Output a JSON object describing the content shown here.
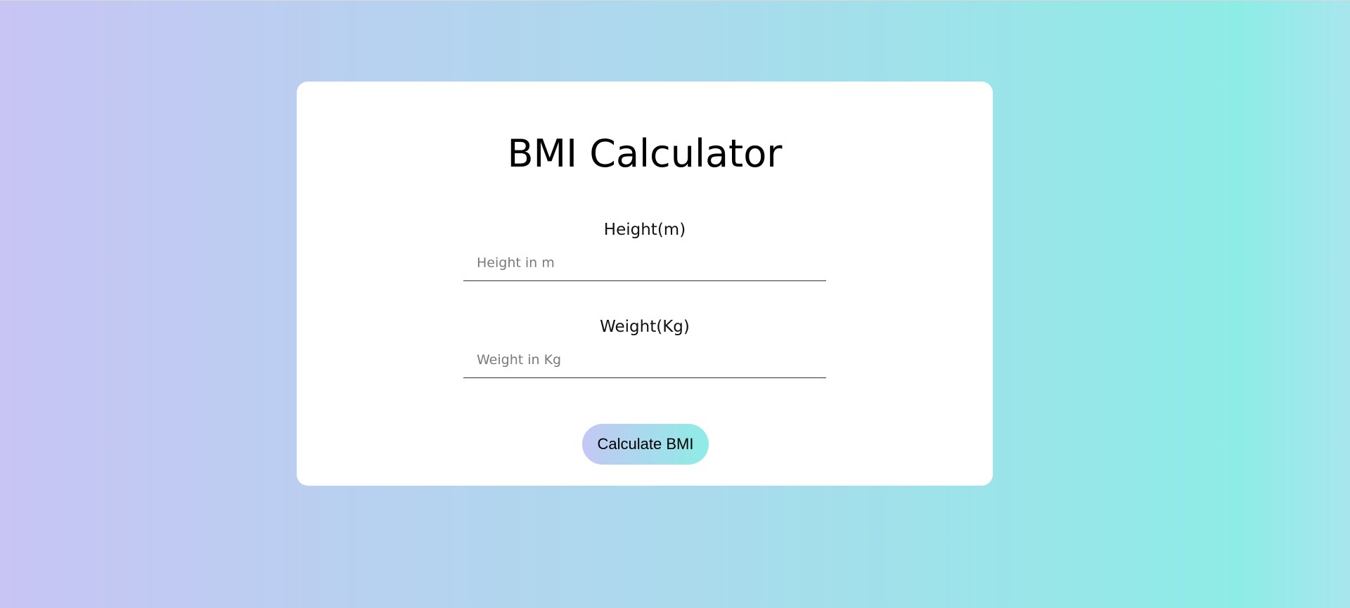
{
  "page": {
    "background_colors": [
      "#c8c4f4",
      "#b9d0f0",
      "#a8dcec",
      "#8eece6",
      "#a8e6ee"
    ]
  },
  "card": {
    "title": "BMI Calculator",
    "height_field": {
      "label": "Height(m)",
      "placeholder": "Height in m",
      "value": ""
    },
    "weight_field": {
      "label": "Weight(Kg)",
      "placeholder": "Weight in Kg",
      "value": ""
    },
    "calculate_button": {
      "label": "Calculate BMI",
      "gradient": [
        "#c3c8f4",
        "#8eece6"
      ]
    }
  }
}
